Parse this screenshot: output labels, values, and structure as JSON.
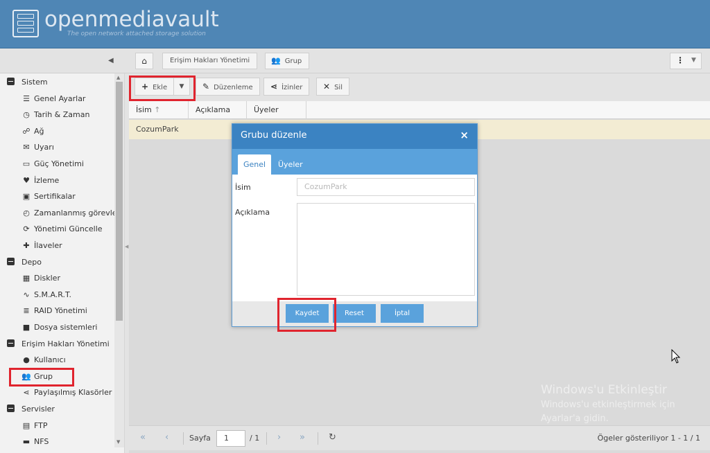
{
  "header": {
    "brand": "openmediavault",
    "tagline": "The open network attached storage solution"
  },
  "breadcrumb": {
    "items": [
      "Erişim Hakları Yönetimi",
      "Grup"
    ]
  },
  "sidebar": {
    "categories": [
      {
        "label": "Sistem",
        "items": [
          {
            "label": "Genel Ayarlar",
            "icon": "sliders-icon"
          },
          {
            "label": "Tarih & Zaman",
            "icon": "clock-icon"
          },
          {
            "label": "Ağ",
            "icon": "network-icon"
          },
          {
            "label": "Uyarı",
            "icon": "envelope-icon"
          },
          {
            "label": "Güç Yönetimi",
            "icon": "battery-icon"
          },
          {
            "label": "İzleme",
            "icon": "heartbeat-icon"
          },
          {
            "label": "Sertifikalar",
            "icon": "certificate-icon"
          },
          {
            "label": "Zamanlanmış görevler",
            "icon": "alarm-clock-icon"
          },
          {
            "label": "Yönetimi Güncelle",
            "icon": "refresh-icon"
          },
          {
            "label": "İlaveler",
            "icon": "puzzle-icon"
          }
        ]
      },
      {
        "label": "Depo",
        "items": [
          {
            "label": "Diskler",
            "icon": "disk-icon"
          },
          {
            "label": "S.M.A.R.T.",
            "icon": "pulse-icon"
          },
          {
            "label": "RAID Yönetimi",
            "icon": "database-icon"
          },
          {
            "label": "Dosya sistemleri",
            "icon": "folder-icon"
          }
        ]
      },
      {
        "label": "Erişim Hakları Yönetimi",
        "items": [
          {
            "label": "Kullanıcı",
            "icon": "user-icon"
          },
          {
            "label": "Grup",
            "icon": "users-icon"
          },
          {
            "label": "Paylaşılmış Klasörler",
            "icon": "share-icon"
          }
        ]
      },
      {
        "label": "Servisler",
        "items": [
          {
            "label": "FTP",
            "icon": "server-icon"
          },
          {
            "label": "NFS",
            "icon": "monitor-icon"
          }
        ]
      }
    ]
  },
  "toolbar": {
    "add_label": "Ekle",
    "edit_label": "Düzenleme",
    "permissions_label": "İzinler",
    "delete_label": "Sil"
  },
  "grid": {
    "columns": [
      "İsim",
      "Açıklama",
      "Üyeler"
    ],
    "rows": [
      {
        "name": "CozumPark",
        "description": "",
        "members": ""
      }
    ]
  },
  "pager": {
    "page_label": "Sayfa",
    "page_value": "1",
    "page_total": "/ 1",
    "status": "Ögeler gösteriliyor 1 - 1 / 1"
  },
  "watermark": {
    "line1": "Windows'u Etkinleştir",
    "line2": "Windows'u etkinleştirmek için",
    "line3": "Ayarlar'a gidin."
  },
  "dialog": {
    "title": "Grubu düzenle",
    "close_glyph": "×",
    "tabs": [
      "Genel",
      "Üyeler"
    ],
    "name_label": "İsim",
    "name_value": "CozumPark",
    "description_label": "Açıklama",
    "save_label": "Kaydet",
    "reset_label": "Reset",
    "cancel_label": "İptal"
  },
  "colors": {
    "header": "#4f86b5",
    "dialog_header": "#3b83c2",
    "dialog_accent": "#5aa2dc",
    "highlight": "#e0242e",
    "selected_row": "#f3ecd3"
  }
}
